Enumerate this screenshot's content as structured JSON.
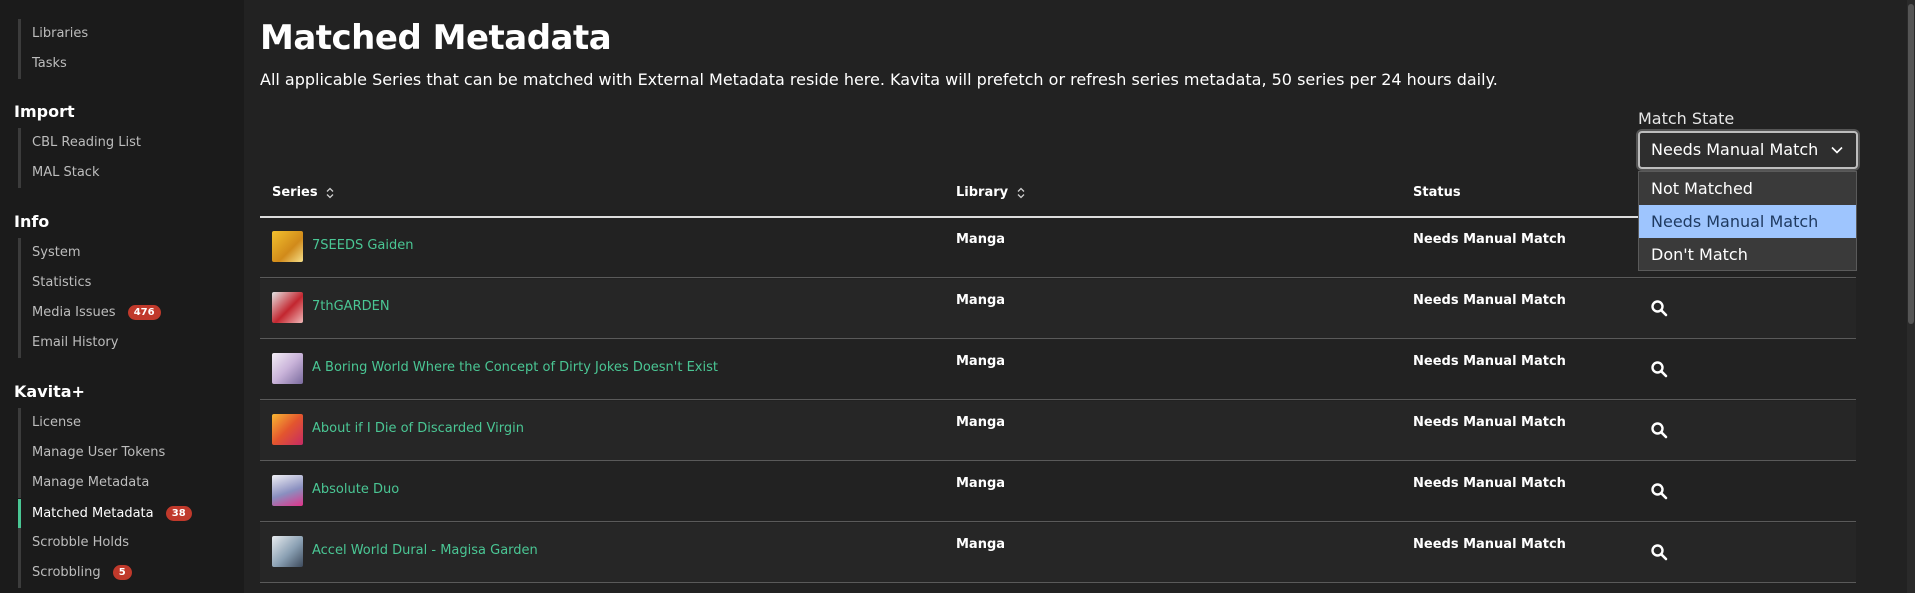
{
  "sidebar": {
    "top_items": [
      {
        "label": "Libraries"
      },
      {
        "label": "Tasks"
      }
    ],
    "sections": [
      {
        "title": "Import",
        "items": [
          {
            "label": "CBL Reading List"
          },
          {
            "label": "MAL Stack"
          }
        ]
      },
      {
        "title": "Info",
        "items": [
          {
            "label": "System"
          },
          {
            "label": "Statistics"
          },
          {
            "label": "Media Issues",
            "badge": "476"
          },
          {
            "label": "Email History"
          }
        ]
      },
      {
        "title": "Kavita+",
        "items": [
          {
            "label": "License"
          },
          {
            "label": "Manage User Tokens"
          },
          {
            "label": "Manage Metadata"
          },
          {
            "label": "Matched Metadata",
            "badge": "38",
            "active": true
          },
          {
            "label": "Scrobble Holds"
          },
          {
            "label": "Scrobbling",
            "badge": "5"
          }
        ]
      }
    ]
  },
  "main": {
    "title": "Matched Metadata",
    "description": "All applicable Series that can be matched with External Metadata reside here. Kavita will prefetch or refresh series metadata, 50 series per 24 hours daily.",
    "filter": {
      "label": "Match State",
      "selected": "Needs Manual Match",
      "options": [
        "Not Matched",
        "Needs Manual Match",
        "Don't Match"
      ],
      "highlighted_index": 1
    },
    "table": {
      "columns": [
        "Series",
        "Library",
        "Status"
      ],
      "rows": [
        {
          "series": "7SEEDS Gaiden",
          "library": "Manga",
          "status": "Needs Manual Match"
        },
        {
          "series": "7thGARDEN",
          "library": "Manga",
          "status": "Needs Manual Match"
        },
        {
          "series": "A Boring World Where the Concept of Dirty Jokes Doesn't Exist",
          "library": "Manga",
          "status": "Needs Manual Match"
        },
        {
          "series": "About if I Die of Discarded Virgin",
          "library": "Manga",
          "status": "Needs Manual Match"
        },
        {
          "series": "Absolute Duo",
          "library": "Manga",
          "status": "Needs Manual Match"
        },
        {
          "series": "Accel World Dural - Magisa Garden",
          "library": "Manga",
          "status": "Needs Manual Match"
        }
      ]
    }
  },
  "colors": {
    "accent": "#4ac694",
    "badge": "#c0392b",
    "dropdown_highlight": "#9ec5fe"
  },
  "icons": {
    "sort": "sort-icon",
    "search": "search-icon",
    "chevron": "chevron-down-icon"
  }
}
